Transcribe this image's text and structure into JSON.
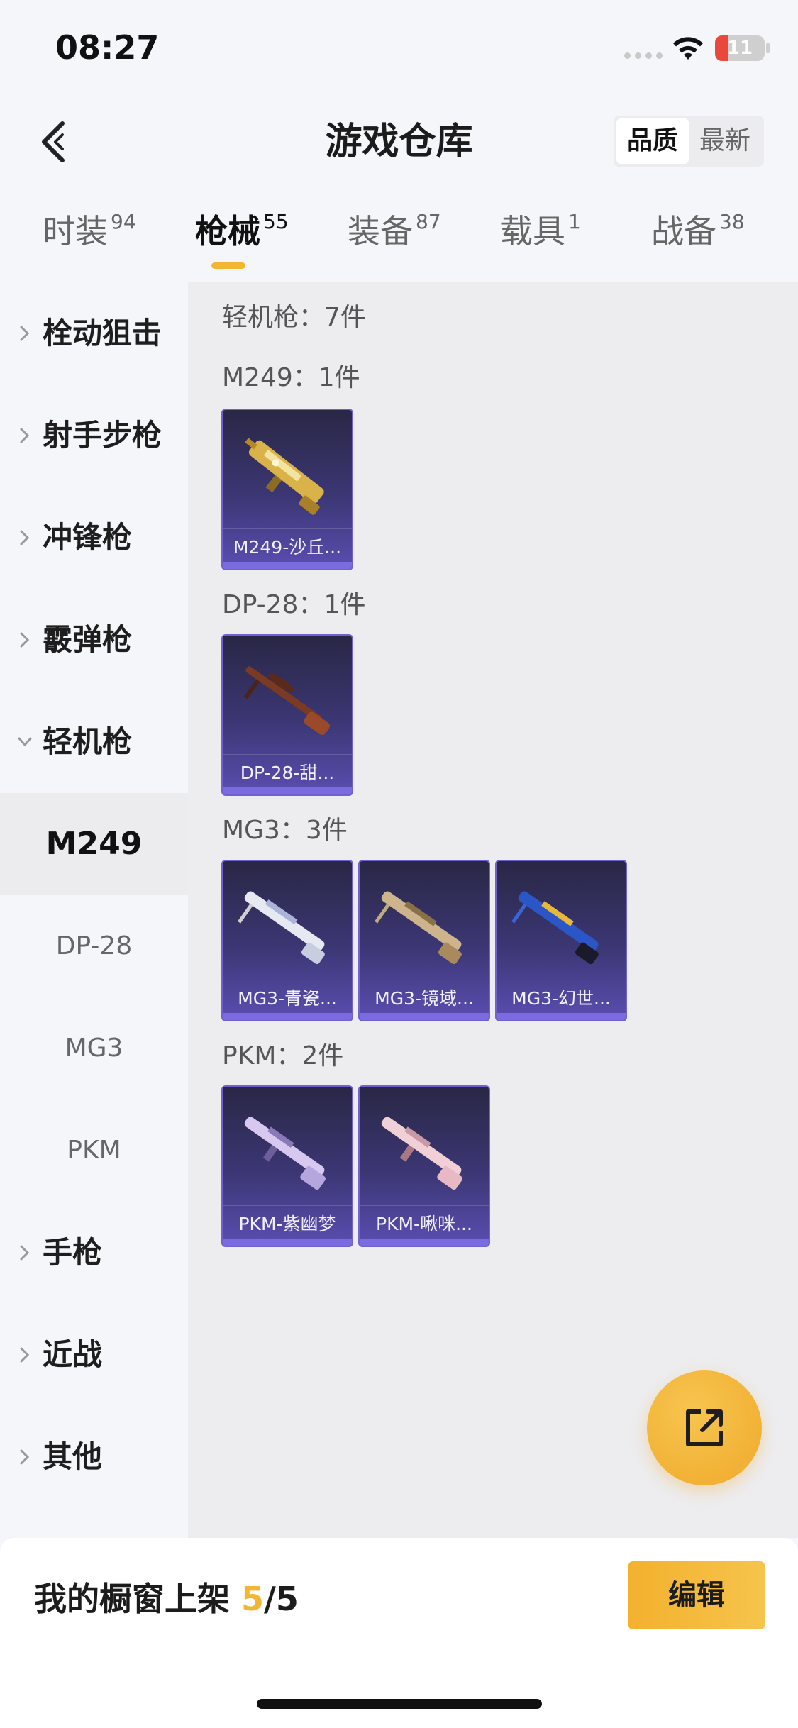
{
  "status_bar": {
    "time": "08:27",
    "battery": "11",
    "battery_level": 0.11
  },
  "header": {
    "title": "游戏仓库",
    "sort_options": [
      "品质",
      "最新"
    ],
    "sort_active": 0
  },
  "tabs": [
    {
      "label": "时装",
      "count": "94"
    },
    {
      "label": "枪械",
      "count": "55"
    },
    {
      "label": "装备",
      "count": "87"
    },
    {
      "label": "载具",
      "count": "1"
    },
    {
      "label": "战备",
      "count": "38"
    }
  ],
  "active_tab": "枪械",
  "sidebar": {
    "categories": [
      {
        "label": "栓动狙击",
        "expanded": false
      },
      {
        "label": "射手步枪",
        "expanded": false
      },
      {
        "label": "冲锋枪",
        "expanded": false
      },
      {
        "label": "霰弹枪",
        "expanded": false
      },
      {
        "label": "轻机枪",
        "expanded": true
      }
    ],
    "subitems": [
      "M249",
      "DP-28",
      "MG3",
      "PKM"
    ],
    "active_subitem": "M249",
    "more_categories": [
      {
        "label": "手枪"
      },
      {
        "label": "近战"
      },
      {
        "label": "其他"
      }
    ]
  },
  "content": {
    "category_heading": "轻机枪：7件",
    "groups": [
      {
        "title": "M249：1件",
        "items": [
          "M249-沙丘..."
        ]
      },
      {
        "title": "DP-28：1件",
        "items": [
          "DP-28-甜..."
        ]
      },
      {
        "title": "MG3：3件",
        "items": [
          "MG3-青瓷...",
          "MG3-镜域...",
          "MG3-幻世..."
        ]
      },
      {
        "title": "PKM：2件",
        "items": [
          "PKM-紫幽梦",
          "PKM-啾咪..."
        ]
      }
    ]
  },
  "bottom_bar": {
    "label": "我的橱窗上架",
    "current": "5",
    "separator": "/",
    "total": "5",
    "edit_label": "编辑"
  },
  "colors": {
    "accent": "#f2b632",
    "card_purple": "#5a4eb1"
  }
}
